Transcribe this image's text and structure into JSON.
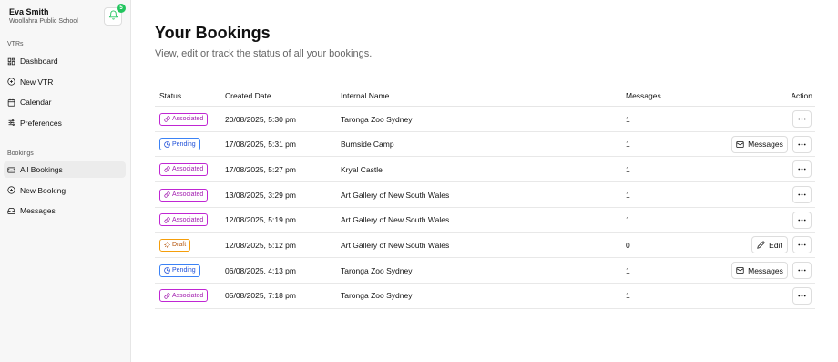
{
  "user": {
    "name": "Eva Smith",
    "school": "Woollahra Public School"
  },
  "notifications": {
    "count": "5",
    "icon": "bell-icon"
  },
  "sidebar": {
    "vtrs_heading": "VTRs",
    "vtrs_items": [
      {
        "label": "Dashboard",
        "icon": "dashboard-icon"
      },
      {
        "label": "New VTR",
        "icon": "plus-circle-icon"
      },
      {
        "label": "Calendar",
        "icon": "calendar-icon"
      },
      {
        "label": "Preferences",
        "icon": "sliders-icon"
      }
    ],
    "bookings_heading": "Bookings",
    "bookings_items": [
      {
        "label": "All Bookings",
        "icon": "bookings-icon",
        "active": true
      },
      {
        "label": "New Booking",
        "icon": "plus-circle-icon"
      },
      {
        "label": "Messages",
        "icon": "inbox-icon"
      }
    ]
  },
  "page": {
    "title": "Your Bookings",
    "subtitle": "View, edit or track the status of all your bookings."
  },
  "table": {
    "columns": [
      "Status",
      "Created Date",
      "Internal Name",
      "Messages",
      "Action"
    ],
    "rows": [
      {
        "status": "Associated",
        "status_type": "associated",
        "created": "20/08/2025, 5:30 pm",
        "name": "Taronga Zoo Sydney",
        "messages": "1",
        "action": ""
      },
      {
        "status": "Pending",
        "status_type": "pending",
        "created": "17/08/2025, 5:31 pm",
        "name": "Burnside Camp",
        "messages": "1",
        "action": "Messages"
      },
      {
        "status": "Associated",
        "status_type": "associated",
        "created": "17/08/2025, 5:27 pm",
        "name": "Kryal Castle",
        "messages": "1",
        "action": ""
      },
      {
        "status": "Associated",
        "status_type": "associated",
        "created": "13/08/2025, 3:29 pm",
        "name": "Art Gallery of New South Wales",
        "messages": "1",
        "action": ""
      },
      {
        "status": "Associated",
        "status_type": "associated",
        "created": "12/08/2025, 5:19 pm",
        "name": "Art Gallery of New South Wales",
        "messages": "1",
        "action": ""
      },
      {
        "status": "Draft",
        "status_type": "draft",
        "created": "12/08/2025, 5:12 pm",
        "name": "Art Gallery of New South Wales",
        "messages": "0",
        "action": "Edit"
      },
      {
        "status": "Pending",
        "status_type": "pending",
        "created": "06/08/2025, 4:13 pm",
        "name": "Taronga Zoo Sydney",
        "messages": "1",
        "action": "Messages"
      },
      {
        "status": "Associated",
        "status_type": "associated",
        "created": "05/08/2025, 7:18 pm",
        "name": "Taronga Zoo Sydney",
        "messages": "1",
        "action": ""
      }
    ]
  },
  "colors": {
    "associated": "#c026d3",
    "pending": "#3b82f6",
    "draft": "#f59e0b",
    "badge_green": "#22c55e"
  }
}
